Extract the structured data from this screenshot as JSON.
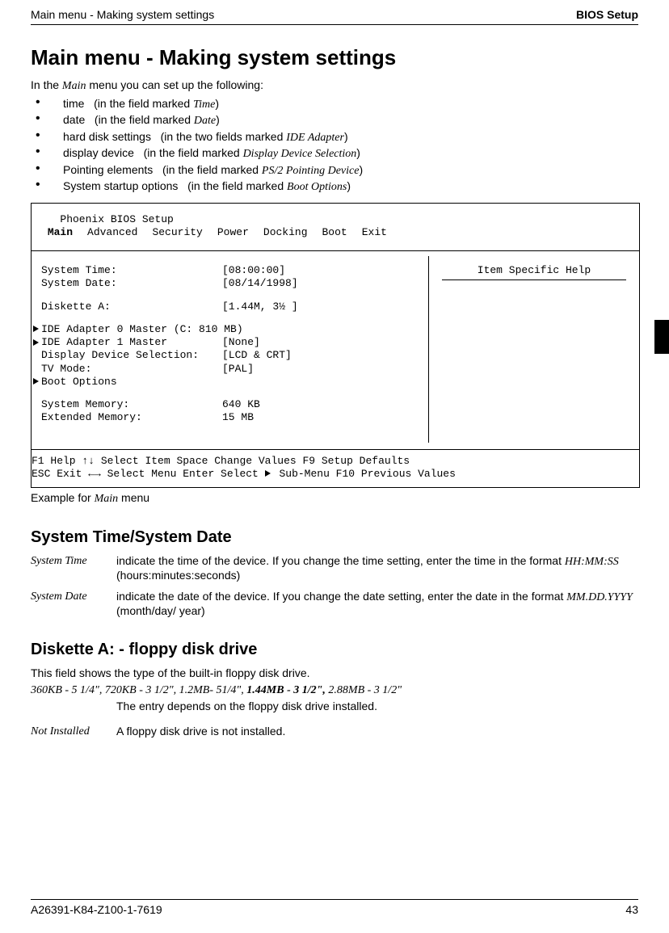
{
  "header": {
    "left": "Main menu - Making system settings",
    "right": "BIOS Setup"
  },
  "h1": "Main menu - Making system settings",
  "intro": {
    "prefix": "In the ",
    "menu_word": "Main",
    "suffix": " menu you can set up the following:"
  },
  "bullets": [
    {
      "label": "time",
      "paren_prefix": "(in the field marked ",
      "field": "Time",
      "paren_suffix": ")"
    },
    {
      "label": "date",
      "paren_prefix": "(in the field marked ",
      "field": "Date",
      "paren_suffix": ")"
    },
    {
      "label": "hard disk settings",
      "paren_prefix": "(in the two fields marked ",
      "field": "IDE Adapter",
      "paren_suffix": ")"
    },
    {
      "label": "display device",
      "paren_prefix": "(in the field marked ",
      "field": "Display Device Selection",
      "paren_suffix": ")"
    },
    {
      "label": "Pointing elements",
      "paren_prefix": "(in the field marked ",
      "field": "PS/2 Pointing Device",
      "paren_suffix": ")"
    },
    {
      "label": "System startup options",
      "paren_prefix": "(in the field marked ",
      "field": "Boot Options",
      "paren_suffix": ")"
    }
  ],
  "bios": {
    "title": "Phoenix BIOS Setup",
    "menu": [
      "Main",
      "Advanced",
      "Security",
      "Power",
      "Docking",
      "Boot",
      "Exit"
    ],
    "rows": {
      "time_label": "System Time:",
      "time_value": "[08:00:00]",
      "date_label": "System Date:",
      "date_value": "[08/14/1998]",
      "disk_label": "Diskette A:",
      "disk_value": "[1.44M, 3½ ]",
      "ide0": "IDE Adapter 0 Master (C: 810 MB)",
      "ide1_label": "IDE Adapter 1 Master",
      "ide1_value": "[None]",
      "dds_label": "Display Device Selection:",
      "dds_value": "[LCD & CRT]",
      "tv_label": "TV Mode:",
      "tv_value": "[PAL]",
      "boot_options": "Boot Options",
      "sysmem_label": "System Memory:",
      "sysmem_value": "640 KB",
      "extmem_label": "Extended Memory:",
      "extmem_value": "15 MB"
    },
    "help_title": "Item Specific Help",
    "footer": {
      "line1_a": "F1  Help  ",
      "arrows_ud": "↑↓",
      "line1_b": "  Select Item  Space  Change Values     F9 Setup Defaults",
      "line2_a": "ESC Exit  ",
      "arrows_lr": "←→",
      "line2_b": " Select Menu  Enter  Select ",
      "line2_c": " Sub-Menu  F10 Previous Values"
    }
  },
  "caption": {
    "prefix": "Example for ",
    "ital": "Main",
    "suffix": " menu"
  },
  "h2_time": "System Time/System Date",
  "defs": {
    "time_term": "System Time",
    "time_desc_a": "indicate the time of the device. If you change the time setting, enter the time in the format ",
    "time_fmt": "HH:MM:SS",
    "time_desc_b": " (hours:minutes:seconds)",
    "date_term": "System Date",
    "date_desc_a": "indicate the date of the device. If you change the date setting, enter the date in the format ",
    "date_fmt": "MM.DD.YYYY",
    "date_desc_b": " (month/day/ year)"
  },
  "h2_disk": "Diskette A: - floppy disk drive",
  "disk_intro": "This field shows the type of the built-in floppy disk drive.",
  "disk_options": {
    "a": "360KB - 5 1/4\", 720KB - 3 1/2\", 1.2MB- 51/4\", ",
    "bold": "1.44MB - 3 1/2\",",
    "b": " 2.88MB - 3 1/2\""
  },
  "disk_option_desc": "The entry depends on the floppy disk drive installed.",
  "not_installed_term": "Not Installed",
  "not_installed_desc": "A floppy disk drive is not installed.",
  "footer": {
    "left": "A26391-K84-Z100-1-7619",
    "right": "43"
  }
}
